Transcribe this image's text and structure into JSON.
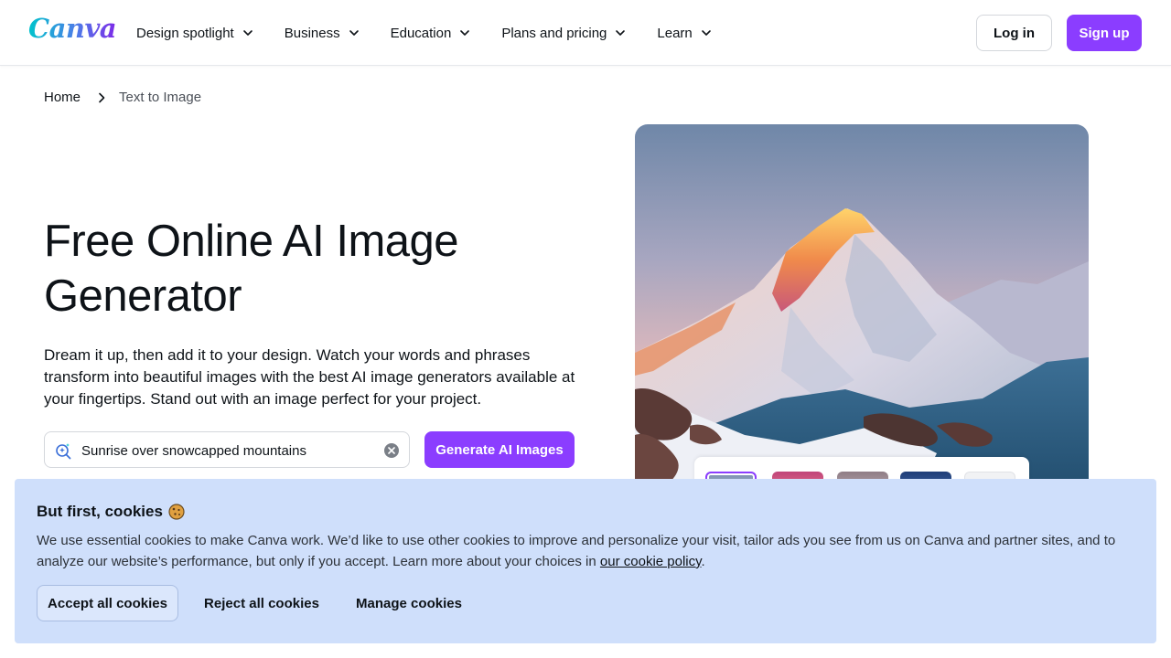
{
  "header": {
    "logo": "Canva",
    "nav": [
      {
        "label": "Design spotlight"
      },
      {
        "label": "Business"
      },
      {
        "label": "Education"
      },
      {
        "label": "Plans and pricing"
      },
      {
        "label": "Learn"
      }
    ],
    "login_label": "Log in",
    "signup_label": "Sign up"
  },
  "breadcrumb": {
    "home": "Home",
    "current": "Text to Image"
  },
  "hero": {
    "title": "Free Online AI Image Generator",
    "description": "Dream it up, then add it to your design. Watch your words and phrases transform into beautiful images with the best AI image generators available at your fingertips. Stand out with an image perfect for your project.",
    "prompt_value": "Sunrise over snowcapped mountains",
    "generate_label": "Generate AI Images"
  },
  "cookie_banner": {
    "title": "But first, cookies",
    "text_before_link": "We use essential cookies to make Canva work. We’d like to use other cookies to improve and personalize your visit, tailor ads you see from us on Canva and partner sites, and to analyze our website’s performance, but only if you accept. Learn more about your choices in ",
    "link_text": "our cookie policy",
    "text_after_link": ".",
    "accept_label": "Accept all cookies",
    "reject_label": "Reject all cookies",
    "manage_label": "Manage cookies"
  },
  "colors": {
    "brand_purple": "#8b3dff",
    "cookie_bg": "#cfdffb"
  }
}
